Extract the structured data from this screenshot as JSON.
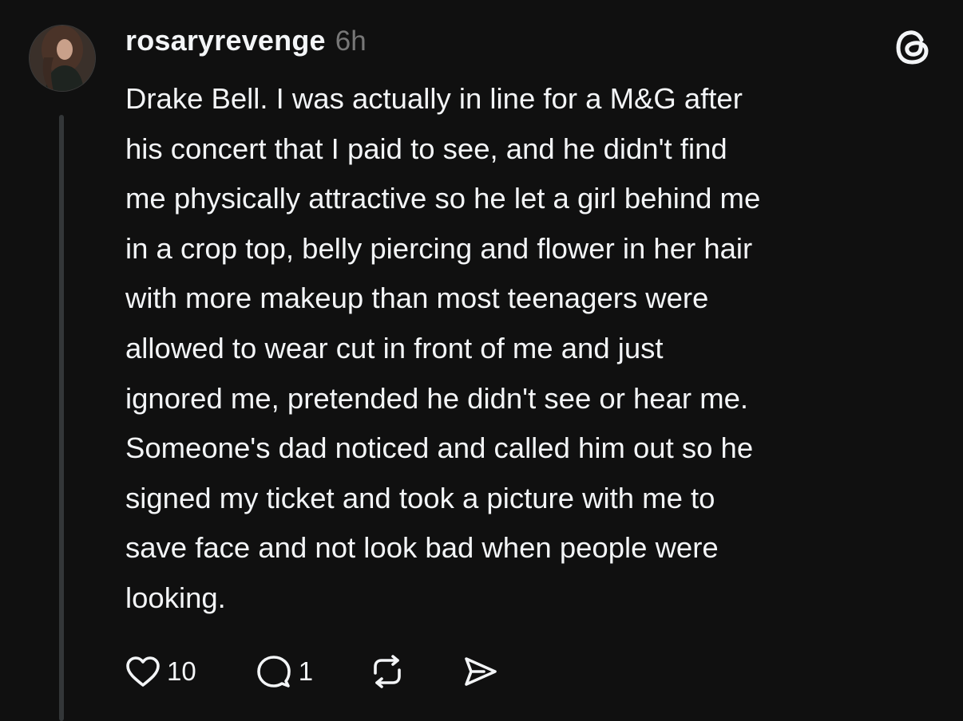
{
  "post": {
    "username": "rosaryrevenge",
    "timestamp": "6h",
    "body": "Drake Bell. I was actually in line for a M&G after\nhis concert that I paid to see, and he didn't find\nme physically attractive so he let a girl behind me\nin a crop top, belly piercing and flower in her hair\nwith more makeup than most teenagers were\nallowed to wear cut in front of me and just\nignored me, pretended he didn't see or hear me.\nSomeone's dad noticed and called him out so he\nsigned my ticket and took a picture with me to\nsave face and not look bad when people were\nlooking.",
    "avatar_icon": "profile-photo",
    "brand_icon": "threads-logo-icon"
  },
  "actions": {
    "like": {
      "icon": "heart-icon",
      "count": "10"
    },
    "reply": {
      "icon": "comment-icon",
      "count": "1"
    },
    "repost": {
      "icon": "repost-icon"
    },
    "share": {
      "icon": "send-icon"
    }
  },
  "colors": {
    "background": "#101010",
    "text": "#f3f5f7",
    "muted": "#777777",
    "thread_line": "#333638"
  }
}
